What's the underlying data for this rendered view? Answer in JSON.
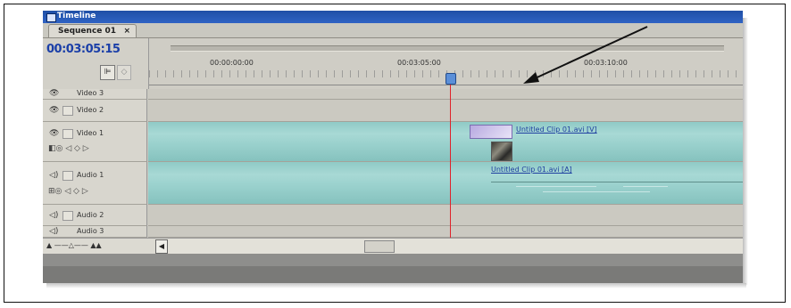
{
  "app": {
    "title": "Timeline"
  },
  "tabs": [
    {
      "label": "Sequence 01",
      "close": "×"
    }
  ],
  "timecode": "00:03:05:15",
  "ruler": {
    "labels": [
      "00:00:00:00",
      "00:03:05:00",
      "00:03:10:00"
    ]
  },
  "tracks": [
    {
      "name": "Video 3",
      "type": "video",
      "collapsed": true
    },
    {
      "name": "Video 2",
      "type": "video",
      "collapsed": true
    },
    {
      "name": "Video 1",
      "type": "video",
      "collapsed": false
    },
    {
      "name": "Audio 1",
      "type": "audio",
      "collapsed": false
    },
    {
      "name": "Audio 2",
      "type": "audio",
      "collapsed": true
    },
    {
      "name": "Audio 3",
      "type": "audio",
      "collapsed": true
    }
  ],
  "clips": {
    "video": {
      "label": "Untitled Clip 01.avi [V]"
    },
    "audio": {
      "label": "Untitled Clip 01.avi [A]"
    }
  },
  "icons": {
    "eye": "eye-icon",
    "speaker": "speaker-icon",
    "snap": "snap-icon",
    "marker": "marker-icon",
    "playhead": "playhead-icon",
    "arrow": "annotation-arrow-icon"
  },
  "colors": {
    "timecode": "#1b3fa8",
    "playhead": "#e0222b",
    "clip": "#98d0cc",
    "titlebar": "#2f63c4"
  }
}
